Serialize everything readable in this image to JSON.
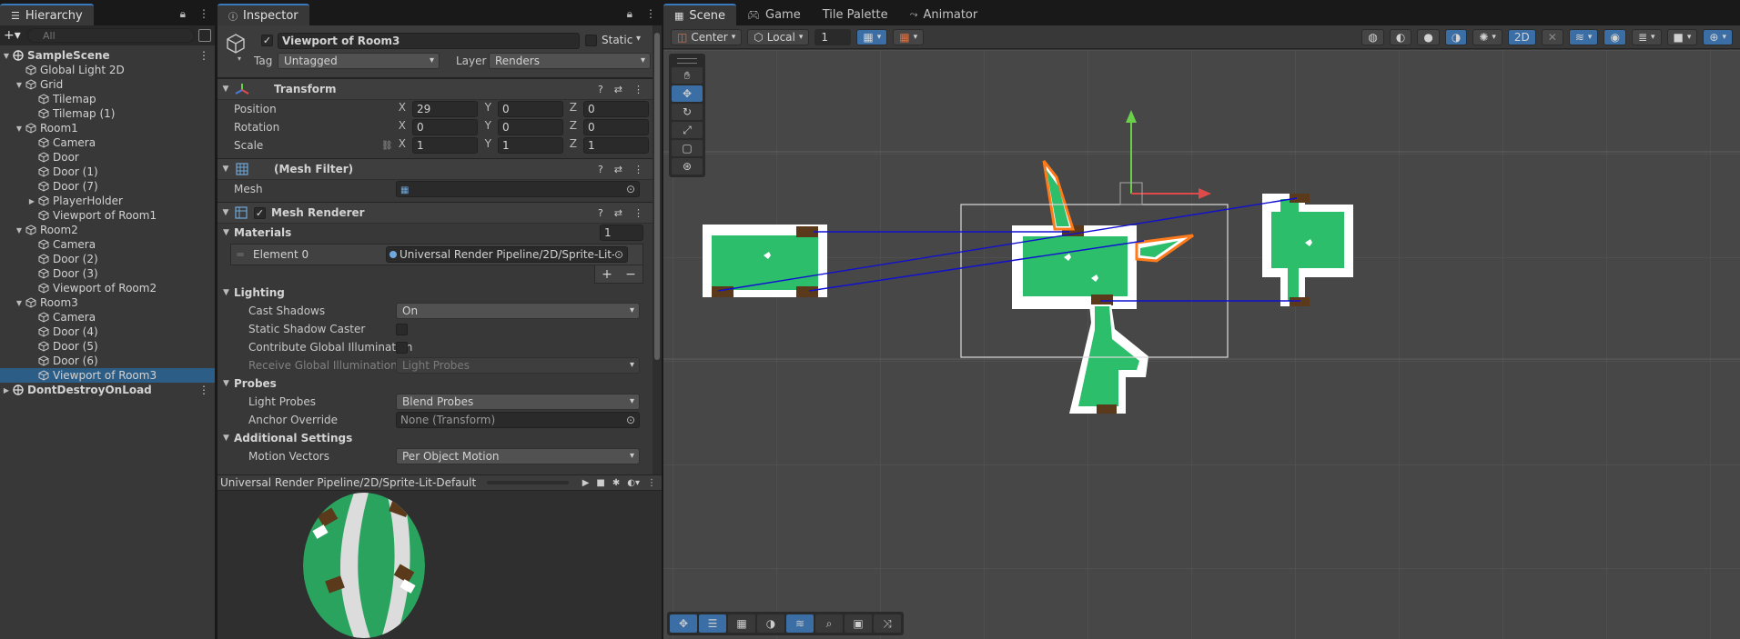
{
  "hierarchy": {
    "tab": "Hierarchy",
    "search_placeholder": "All",
    "items": [
      {
        "label": "SampleScene",
        "depth": 0,
        "type": "scene",
        "expanded": true,
        "kebab": true
      },
      {
        "label": "Global Light 2D",
        "depth": 1,
        "type": "cube"
      },
      {
        "label": "Grid",
        "depth": 1,
        "type": "cube",
        "expanded": true
      },
      {
        "label": "Tilemap",
        "depth": 2,
        "type": "cube"
      },
      {
        "label": "Tilemap (1)",
        "depth": 2,
        "type": "cube"
      },
      {
        "label": "Room1",
        "depth": 1,
        "type": "cube",
        "expanded": true
      },
      {
        "label": "Camera",
        "depth": 2,
        "type": "cube"
      },
      {
        "label": "Door",
        "depth": 2,
        "type": "cube"
      },
      {
        "label": "Door (1)",
        "depth": 2,
        "type": "cube"
      },
      {
        "label": "Door (7)",
        "depth": 2,
        "type": "cube"
      },
      {
        "label": "PlayerHolder",
        "depth": 2,
        "type": "cube",
        "collapsed": true
      },
      {
        "label": "Viewport of Room1",
        "depth": 2,
        "type": "cube"
      },
      {
        "label": "Room2",
        "depth": 1,
        "type": "cube",
        "expanded": true
      },
      {
        "label": "Camera",
        "depth": 2,
        "type": "cube"
      },
      {
        "label": "Door (2)",
        "depth": 2,
        "type": "cube"
      },
      {
        "label": "Door (3)",
        "depth": 2,
        "type": "cube"
      },
      {
        "label": "Viewport of Room2",
        "depth": 2,
        "type": "cube"
      },
      {
        "label": "Room3",
        "depth": 1,
        "type": "cube",
        "expanded": true
      },
      {
        "label": "Camera",
        "depth": 2,
        "type": "cube"
      },
      {
        "label": "Door (4)",
        "depth": 2,
        "type": "cube"
      },
      {
        "label": "Door (5)",
        "depth": 2,
        "type": "cube"
      },
      {
        "label": "Door (6)",
        "depth": 2,
        "type": "cube"
      },
      {
        "label": "Viewport of Room3",
        "depth": 2,
        "type": "cube",
        "selected": true
      },
      {
        "label": "DontDestroyOnLoad",
        "depth": 0,
        "type": "scene",
        "collapsed": true,
        "kebab": true
      }
    ]
  },
  "inspector": {
    "tab": "Inspector",
    "object_name": "Viewport of Room3",
    "static_label": "Static",
    "tag_label": "Tag",
    "tag_value": "Untagged",
    "layer_label": "Layer",
    "layer_value": "Renders",
    "transform": {
      "title": "Transform",
      "position_label": "Position",
      "rotation_label": "Rotation",
      "scale_label": "Scale",
      "position": [
        "29",
        "0",
        "0"
      ],
      "rotation": [
        "0",
        "0",
        "0"
      ],
      "scale": [
        "1",
        "1",
        "1"
      ],
      "axes": [
        "X",
        "Y",
        "Z"
      ]
    },
    "mesh_filter": {
      "title": "(Mesh Filter)",
      "mesh_label": "Mesh"
    },
    "mesh_renderer": {
      "title": "Mesh Renderer",
      "materials_label": "Materials",
      "materials_count": "1",
      "element0_label": "Element 0",
      "element0_value": "Universal Render Pipeline/2D/Sprite-Lit-",
      "lighting_label": "Lighting",
      "cast_shadows_label": "Cast Shadows",
      "cast_shadows_value": "On",
      "static_shadow_label": "Static Shadow Caster",
      "contribute_gi_label": "Contribute Global Illumination",
      "receive_gi_label": "Receive Global Illumination",
      "receive_gi_value": "Light Probes",
      "probes_label": "Probes",
      "light_probes_label": "Light Probes",
      "light_probes_value": "Blend Probes",
      "anchor_label": "Anchor Override",
      "anchor_value": "None (Transform)",
      "additional_label": "Additional Settings",
      "motion_label": "Motion Vectors",
      "motion_value": "Per Object Motion"
    },
    "preview_title": "Universal Render Pipeline/2D/Sprite-Lit-Default"
  },
  "scene": {
    "tabs": [
      "Scene",
      "Game",
      "Tile Palette",
      "Animator"
    ],
    "pivot_label": "Center",
    "space_label": "Local",
    "snap_value": "1",
    "mode_2d": "2D"
  },
  "colors": {
    "accent": "#3a79bb",
    "selection": "#2c5d87",
    "room_green": "#2dbe6c",
    "room_white": "#ffffff",
    "door_brown": "#5a3a1a",
    "highlight_orange": "#ff7a1a",
    "link_blue": "#1010d0"
  }
}
